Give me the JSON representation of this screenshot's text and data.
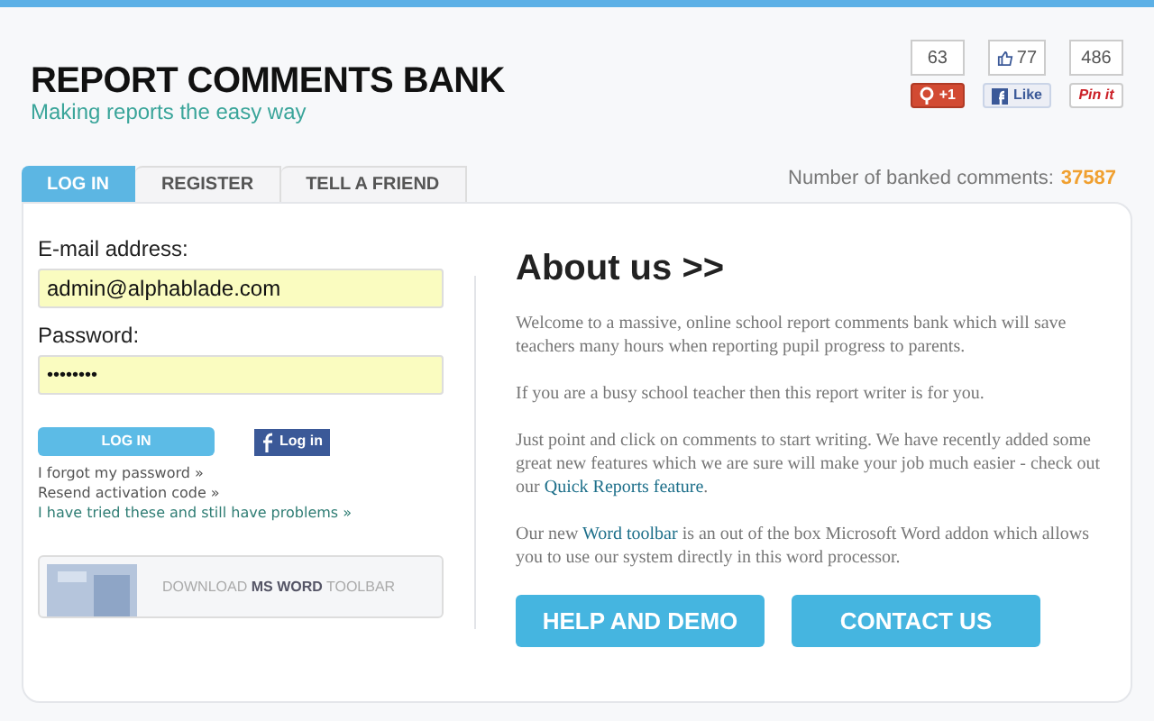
{
  "header": {
    "title": "REPORT COMMENTS BANK",
    "tagline": "Making reports the easy way"
  },
  "social": [
    {
      "kind": "google",
      "count": "63",
      "label": "+1"
    },
    {
      "kind": "facebook",
      "count": "77",
      "label": "Like"
    },
    {
      "kind": "pinterest",
      "count": "486",
      "label": "Pin it"
    }
  ],
  "tabs": [
    {
      "label": "LOG IN",
      "selected": true
    },
    {
      "label": "REGISTER",
      "selected": false
    },
    {
      "label": "TELL A FRIEND",
      "selected": false
    }
  ],
  "counter": {
    "label": "Number of banked comments:",
    "value": "37587"
  },
  "login": {
    "email_label": "E-mail address:",
    "email_value": "admin@alphablade.com",
    "password_label": "Password:",
    "password_value": "••••••••",
    "login_button": "LOG IN",
    "facebook_button": "Log in",
    "links": [
      "I forgot my password »",
      "Resend activation code »",
      "I have tried these and still have problems »"
    ],
    "toolbar_button": "DOWNLOAD **MS WORD** TOOLBAR"
  },
  "about": {
    "heading": "About us >>",
    "paragraphs": [
      [
        {
          "kind": "text",
          "text": "Welcome to a massive, online school report comments bank which will save teachers many hours when reporting pupil progress to parents."
        }
      ],
      [
        {
          "kind": "text",
          "text": "If you are a busy school teacher then this report writer is for you."
        }
      ],
      [
        {
          "kind": "text",
          "text": "Just point and click on comments to start writing. We have recently added some great new features which we are sure will make your job much easier - check out our "
        },
        {
          "kind": "link",
          "text": "Quick Reports feature"
        },
        {
          "kind": "text",
          "text": "."
        }
      ],
      [
        {
          "kind": "text",
          "text": "Our new "
        },
        {
          "kind": "link",
          "text": "Word toolbar"
        },
        {
          "kind": "text",
          "text": " is an out of the box Microsoft Word addon which allows you to use our system directly in this word processor."
        }
      ]
    ],
    "buttons": [
      "HELP AND DEMO",
      "CONTACT US"
    ]
  }
}
